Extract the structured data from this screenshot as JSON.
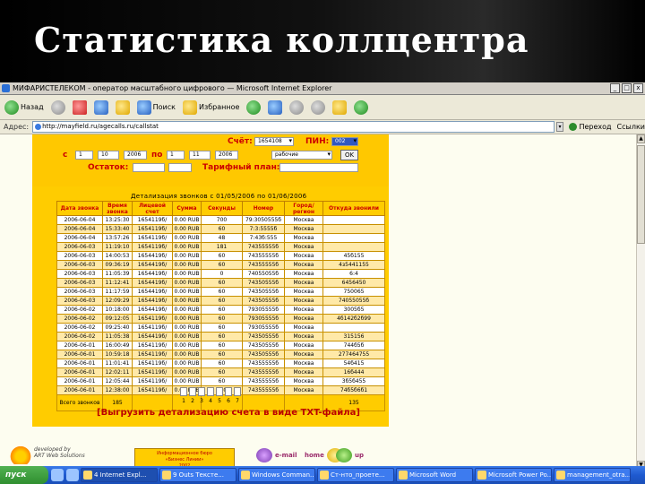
{
  "slide": {
    "title": "Статистика коллцентра"
  },
  "browser": {
    "window_title": "МИФАРИСТЕЛЕКОМ - оператор масштабного цифрового — Microsoft Internet Explorer",
    "toolbar": {
      "back_label": "Назад",
      "search_label": "Поиск",
      "favorites_label": "Избранное"
    },
    "address": {
      "label": "Адрес:",
      "value": "http://mayfield.ru/agecalls.ru/callstat",
      "go_label": "Переход",
      "links_label": "Ссылки"
    }
  },
  "form": {
    "account_label": "Счёт:",
    "account_value": "1654108",
    "pin_label": "ПИН:",
    "pin_value": "002",
    "from_label": "с",
    "from_day": "1",
    "from_month": "10",
    "from_year": "2006",
    "to_label": "по",
    "to_day": "1",
    "to_month": "11",
    "to_year": "2006",
    "period_value": "рабочие",
    "ok_label": "OK",
    "balance_label": "Остаток:",
    "tariff_label": "Тарифный план:"
  },
  "table": {
    "title": "Детализация звонков с 01/05/2006 по 01/06/2006",
    "columns": [
      "Дата звонка",
      "Время звонка",
      "Лицевой счет",
      "Сумма",
      "Секунды",
      "Номер",
      "Город/регион",
      "Откуда звонили"
    ],
    "rows": [
      [
        "2006-06-04",
        "13:25:30",
        "1654119б/",
        "0.00 RUB",
        "700",
        "79:3050555б",
        "Москва",
        ""
      ],
      [
        "2006-06-04",
        "15:33:40",
        "1654119б/",
        "0.00 RUB",
        "60",
        "7:3:5555б",
        "Москва",
        ""
      ],
      [
        "2006-06-04",
        "13:57:26",
        "1654119б/",
        "0.00 RUB",
        "48",
        "7:43б:555",
        "Москва",
        ""
      ],
      [
        "2006-06-03",
        "11:19:10",
        "1654119б/",
        "0.00 RUB",
        "181",
        "74355555б",
        "Москва",
        ""
      ],
      [
        "2006-06-03",
        "14:00:53",
        "1654419б/",
        "0.00 RUB",
        "60",
        "74355555б",
        "Москва",
        "45б155"
      ],
      [
        "2006-06-03",
        "09:36:19",
        "1654419б/",
        "0.00 RUB",
        "60",
        "74355555б",
        "Москва",
        "4з5441155"
      ],
      [
        "2006-06-03",
        "11:05:39",
        "1654419б/",
        "0.00 RUB",
        "0",
        "74055055б",
        "Москва",
        "6:4"
      ],
      [
        "2006-06-03",
        "11:12:41",
        "1654419б/",
        "0.00 RUB",
        "60",
        "74350555б",
        "Москва",
        "6456450"
      ],
      [
        "2006-06-03",
        "11:17:59",
        "1654419б/",
        "0.00 RUB",
        "60",
        "74350555б",
        "Москва",
        "750065"
      ],
      [
        "2006-06-03",
        "12:09:29",
        "1654419б/",
        "0.00 RUB",
        "60",
        "74350555б",
        "Москва",
        "74055055б"
      ],
      [
        "2006-06-02",
        "10:18:00",
        "1654419б/",
        "0.00 RUB",
        "60",
        "79305555б",
        "Москва",
        "3005б5"
      ],
      [
        "2006-06-02",
        "09:12:05",
        "1654119б/",
        "0.00 RUB",
        "60",
        "79305555б",
        "Москва",
        "4б142б2б99"
      ],
      [
        "2006-06-02",
        "09:25:40",
        "1654119б/",
        "0.00 RUB",
        "60",
        "79305555б",
        "Москва",
        ""
      ],
      [
        "2006-06-02",
        "11:05:38",
        "1654419б/",
        "0.00 RUB",
        "60",
        "74350555б",
        "Москва",
        "315156"
      ],
      [
        "2006-06-01",
        "16:00:49",
        "1654119б/",
        "0.00 RUB",
        "60",
        "74350555б",
        "Москва",
        "744б5б"
      ],
      [
        "2006-06-01",
        "10:59:18",
        "1654119б/",
        "0.00 RUB",
        "60",
        "74350555б",
        "Москва",
        "277464755"
      ],
      [
        "2006-06-01",
        "11:01:41",
        "1654119б/",
        "0.00 RUB",
        "60",
        "74355555б",
        "Москва",
        "54б415"
      ],
      [
        "2006-06-01",
        "12:02:11",
        "1654119б/",
        "0.00 RUB",
        "60",
        "74355555б",
        "Москва",
        "16б444"
      ],
      [
        "2006-06-01",
        "12:05:44",
        "1654119б/",
        "0.00 RUB",
        "60",
        "74355555б",
        "Москва",
        "3б5б455"
      ],
      [
        "2006-06-01",
        "12:38:00",
        "1654119б/",
        "0.00 RUB",
        "240",
        "74355555б",
        "Москва",
        "74б5б6б1"
      ]
    ],
    "total": [
      "Всего звонков",
      "185",
      "",
      "",
      "",
      "",
      "",
      "135"
    ]
  },
  "pager": {
    "pages": [
      "1",
      "2",
      "3",
      "4",
      "5",
      "6",
      "7"
    ]
  },
  "export_link": "[Выгрузить детализацию счета в виде TXT-файла]",
  "footer": {
    "developer_text": "developed by\nART Web Solutions",
    "center_text": "Информационное бюро\n«Бизнес Линии»\n2002",
    "email_label": "e-mail",
    "home_label": "home",
    "up_label": "up"
  },
  "taskbar": {
    "start_label": "пуск",
    "tasks": [
      "4 Internet Expl...",
      "9 Outs Тексте...",
      "Windows Comman...",
      "Ст-нто_проете...",
      "Microsoft Word",
      "Microsoft Power Po...",
      "management_otra..."
    ]
  }
}
